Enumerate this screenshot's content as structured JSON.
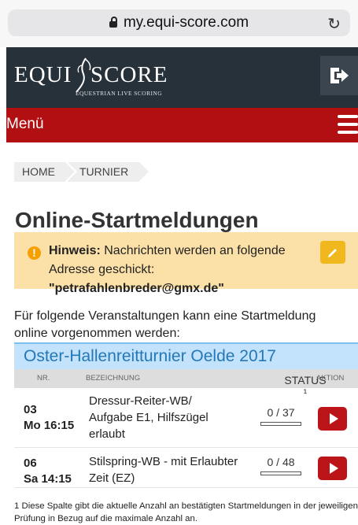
{
  "browser": {
    "status_fragment": "",
    "url": "my.equi-score.com"
  },
  "header": {
    "logo_left": "EQUI",
    "logo_right": "SCORE",
    "tagline": "EQUESTRIAN LIVE SCORING"
  },
  "menu": {
    "label": "Menü"
  },
  "breadcrumb": [
    "HOME",
    "TURNIER"
  ],
  "page": {
    "title": "Online-Startmeldungen",
    "notice_label": "Hinweis:",
    "notice_text": " Nachrichten werden an folgende Adresse geschickt: ",
    "notice_email": "\"petrafahlenbreder@gmx.de\"",
    "intro": "Für folgende Veranstaltungen kann eine Startmeldung online vorgenommen werden:"
  },
  "event": {
    "title": "Oster-Hallenreitturnier Oelde 2017",
    "headers": {
      "nr": "NR.",
      "bezeichnung": "BEZEICHNUNG",
      "status": "STATUS ¹",
      "aktion": "AKTION"
    },
    "rows": [
      {
        "nr": "03",
        "date": "Mo 16:15",
        "bezeichnung": "Dressur-Reiter-WB/ Aufgabe E1, Hilfszügel erlaubt",
        "status": "0 / 37",
        "progress": 0
      },
      {
        "nr": "06",
        "date": "Sa 14:15",
        "bezeichnung": "Stilspring-WB - mit Erlaubter Zeit (EZ)",
        "status": "0 / 48",
        "progress": 0
      }
    ]
  },
  "footnote": "1 Diese Spalte gibt die aktuelle Anzahl an bestätigten Startmeldungen in der jeweiligen Prüfung in Bezug auf die maximale Anzahl an.",
  "colors": {
    "header": "#273139",
    "menu": "#b20f12",
    "notice": "#fbe1a7",
    "event_header": "#c3e2fb",
    "action": "#bb1519"
  },
  "icons": {
    "lock": "lock-icon",
    "reload": "reload-icon",
    "logout": "logout-icon",
    "menu": "hamburger-icon",
    "warning": "warning-icon",
    "edit": "pencil-icon",
    "play": "play-icon"
  }
}
